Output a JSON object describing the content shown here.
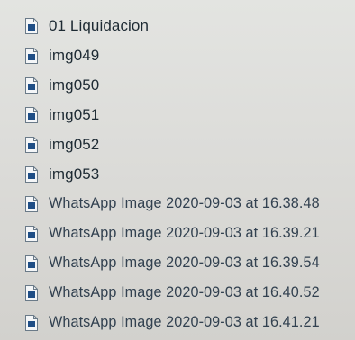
{
  "files": [
    {
      "name": "01 Liquidacion",
      "icon": "document-icon",
      "kind": "doc"
    },
    {
      "name": "img049",
      "icon": "document-icon",
      "kind": "doc"
    },
    {
      "name": "img050",
      "icon": "document-icon",
      "kind": "doc"
    },
    {
      "name": "img051",
      "icon": "document-icon",
      "kind": "doc"
    },
    {
      "name": "img052",
      "icon": "document-icon",
      "kind": "doc"
    },
    {
      "name": "img053",
      "icon": "document-icon",
      "kind": "doc"
    },
    {
      "name": "WhatsApp Image 2020-09-03 at 16.38.48",
      "icon": "image-file-icon",
      "kind": "wa"
    },
    {
      "name": "WhatsApp Image 2020-09-03 at 16.39.21",
      "icon": "image-file-icon",
      "kind": "wa"
    },
    {
      "name": "WhatsApp Image 2020-09-03 at 16.39.54",
      "icon": "image-file-icon",
      "kind": "wa"
    },
    {
      "name": "WhatsApp Image 2020-09-03 at 16.40.52",
      "icon": "image-file-icon",
      "kind": "wa"
    },
    {
      "name": "WhatsApp Image 2020-09-03 at 16.41.21",
      "icon": "image-file-icon",
      "kind": "wa"
    }
  ],
  "colors": {
    "icon_page": "#f4f6f8",
    "icon_border": "#6a7a88",
    "icon_fill": "#1f4e86"
  }
}
